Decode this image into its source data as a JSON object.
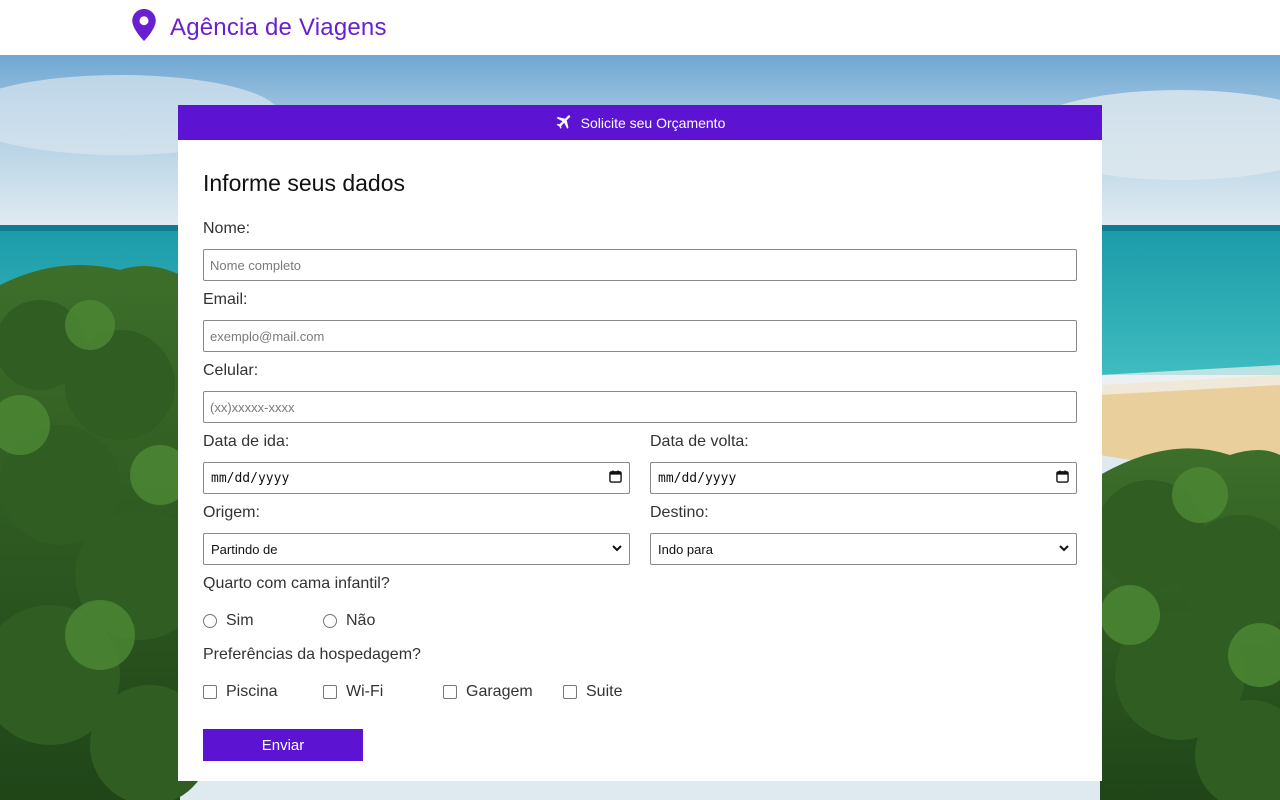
{
  "brand": {
    "title": "Agência de Viagens",
    "icon": "map-pin-icon",
    "color": "#6a1fd1"
  },
  "card": {
    "header_label": "Solicite seu Orçamento",
    "header_icon": "plane-icon",
    "header_color": "#5c14d2"
  },
  "form": {
    "heading": "Informe seus dados",
    "nome_label": "Nome:",
    "nome_placeholder": "Nome completo",
    "email_label": "Email:",
    "email_placeholder": "exemplo@mail.com",
    "celular_label": "Celular:",
    "celular_placeholder": "(xx)xxxxx-xxxx",
    "data_ida_label": "Data de ida:",
    "data_ida_value": "mm/dd/yyyy",
    "data_volta_label": "Data de volta:",
    "data_volta_value": "mm/dd/yyyy",
    "origem_label": "Origem:",
    "origem_selected": "Partindo de",
    "destino_label": "Destino:",
    "destino_selected": "Indo para",
    "quarto_label": "Quarto com cama infantil?",
    "quarto_options": [
      "Sim",
      "Não"
    ],
    "pref_label": "Preferências da hospedagem?",
    "pref_options": [
      "Piscina",
      "Wi-Fi",
      "Garagem",
      "Suite"
    ],
    "submit_label": "Enviar"
  }
}
